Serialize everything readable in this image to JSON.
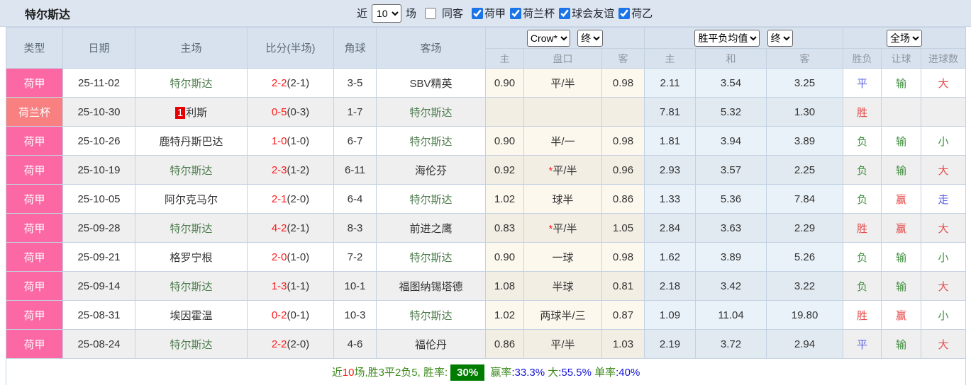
{
  "topbar": {
    "title": "特尔斯达",
    "near_label": "近",
    "matches_count": "10",
    "games_label": "场",
    "same_opponent": {
      "label": "同客",
      "checked": false
    },
    "league_filters": [
      {
        "label": "荷甲",
        "checked": true
      },
      {
        "label": "荷兰杯",
        "checked": true
      },
      {
        "label": "球会友谊",
        "checked": true
      },
      {
        "label": "荷乙",
        "checked": true
      }
    ]
  },
  "table": {
    "columns": {
      "type": "类型",
      "date": "日期",
      "home": "主场",
      "score": "比分(半场)",
      "corner": "角球",
      "away": "客场",
      "sub": [
        "主",
        "盘口",
        "客",
        "主",
        "和",
        "客",
        "胜负",
        "让球",
        "进球数"
      ]
    },
    "selects": {
      "bookmaker": "Crow*",
      "bookmaker_time": "终",
      "avg": "胜平负均值",
      "avg_time": "终",
      "scope": "全场"
    },
    "rows": [
      {
        "league": "荷甲",
        "league_style": "pink",
        "date": "25-11-02",
        "home": "特尔斯达",
        "home_green": true,
        "home_badge": "",
        "score": "2-2",
        "half": "(2-1)",
        "corner": "3-5",
        "away": "SBV精英",
        "away_green": false,
        "odds_home": "0.90",
        "handicap": "平/半",
        "handicap_star": false,
        "odds_away": "0.98",
        "avg_home": "2.11",
        "avg_draw": "3.54",
        "avg_away": "3.25",
        "result": "平",
        "handicap_result": "输",
        "goals": "大"
      },
      {
        "league": "荷兰杯",
        "league_style": "salmon",
        "date": "25-10-30",
        "home": "利斯",
        "home_green": false,
        "home_badge": "1",
        "score": "0-5",
        "half": "(0-3)",
        "corner": "1-7",
        "away": "特尔斯达",
        "away_green": true,
        "odds_home": "",
        "handicap": "",
        "handicap_star": false,
        "odds_away": "",
        "avg_home": "7.81",
        "avg_draw": "5.32",
        "avg_away": "1.30",
        "result": "胜",
        "handicap_result": "",
        "goals": ""
      },
      {
        "league": "荷甲",
        "league_style": "pink",
        "date": "25-10-26",
        "home": "鹿特丹斯巴达",
        "home_green": false,
        "home_badge": "",
        "score": "1-0",
        "half": "(1-0)",
        "corner": "6-7",
        "away": "特尔斯达",
        "away_green": true,
        "odds_home": "0.90",
        "handicap": "半/一",
        "handicap_star": false,
        "odds_away": "0.98",
        "avg_home": "1.81",
        "avg_draw": "3.94",
        "avg_away": "3.89",
        "result": "负",
        "handicap_result": "输",
        "goals": "小"
      },
      {
        "league": "荷甲",
        "league_style": "pink",
        "date": "25-10-19",
        "home": "特尔斯达",
        "home_green": true,
        "home_badge": "",
        "score": "2-3",
        "half": "(1-2)",
        "corner": "6-11",
        "away": "海伦芬",
        "away_green": false,
        "odds_home": "0.92",
        "handicap": "平/半",
        "handicap_star": true,
        "odds_away": "0.96",
        "avg_home": "2.93",
        "avg_draw": "3.57",
        "avg_away": "2.25",
        "result": "负",
        "handicap_result": "输",
        "goals": "大"
      },
      {
        "league": "荷甲",
        "league_style": "pink",
        "date": "25-10-05",
        "home": "阿尔克马尔",
        "home_green": false,
        "home_badge": "",
        "score": "2-1",
        "half": "(2-0)",
        "corner": "6-4",
        "away": "特尔斯达",
        "away_green": true,
        "odds_home": "1.02",
        "handicap": "球半",
        "handicap_star": false,
        "odds_away": "0.86",
        "avg_home": "1.33",
        "avg_draw": "5.36",
        "avg_away": "7.84",
        "result": "负",
        "handicap_result": "赢",
        "goals": "走"
      },
      {
        "league": "荷甲",
        "league_style": "pink",
        "date": "25-09-28",
        "home": "特尔斯达",
        "home_green": true,
        "home_badge": "",
        "score": "4-2",
        "half": "(2-1)",
        "corner": "8-3",
        "away": "前进之鹰",
        "away_green": false,
        "odds_home": "0.83",
        "handicap": "平/半",
        "handicap_star": true,
        "odds_away": "1.05",
        "avg_home": "2.84",
        "avg_draw": "3.63",
        "avg_away": "2.29",
        "result": "胜",
        "handicap_result": "赢",
        "goals": "大"
      },
      {
        "league": "荷甲",
        "league_style": "pink",
        "date": "25-09-21",
        "home": "格罗宁根",
        "home_green": false,
        "home_badge": "",
        "score": "2-0",
        "half": "(1-0)",
        "corner": "7-2",
        "away": "特尔斯达",
        "away_green": true,
        "odds_home": "0.90",
        "handicap": "一球",
        "handicap_star": false,
        "odds_away": "0.98",
        "avg_home": "1.62",
        "avg_draw": "3.89",
        "avg_away": "5.26",
        "result": "负",
        "handicap_result": "输",
        "goals": "小"
      },
      {
        "league": "荷甲",
        "league_style": "pink",
        "date": "25-09-14",
        "home": "特尔斯达",
        "home_green": true,
        "home_badge": "",
        "score": "1-3",
        "half": "(1-1)",
        "corner": "10-1",
        "away": "福图纳锡塔德",
        "away_green": false,
        "odds_home": "1.08",
        "handicap": "半球",
        "handicap_star": false,
        "odds_away": "0.81",
        "avg_home": "2.18",
        "avg_draw": "3.42",
        "avg_away": "3.22",
        "result": "负",
        "handicap_result": "输",
        "goals": "大"
      },
      {
        "league": "荷甲",
        "league_style": "pink",
        "date": "25-08-31",
        "home": "埃因霍温",
        "home_green": false,
        "home_badge": "",
        "score": "0-2",
        "half": "(0-1)",
        "corner": "10-3",
        "away": "特尔斯达",
        "away_green": true,
        "odds_home": "1.02",
        "handicap": "两球半/三",
        "handicap_star": false,
        "odds_away": "0.87",
        "avg_home": "1.09",
        "avg_draw": "11.04",
        "avg_away": "19.80",
        "result": "胜",
        "handicap_result": "赢",
        "goals": "小"
      },
      {
        "league": "荷甲",
        "league_style": "pink",
        "date": "25-08-24",
        "home": "特尔斯达",
        "home_green": true,
        "home_badge": "",
        "score": "2-2",
        "half": "(2-0)",
        "corner": "4-6",
        "away": "福伦丹",
        "away_green": false,
        "odds_home": "0.86",
        "handicap": "平/半",
        "handicap_star": false,
        "odds_away": "1.03",
        "avg_home": "2.19",
        "avg_draw": "3.72",
        "avg_away": "2.94",
        "result": "平",
        "handicap_result": "输",
        "goals": "大"
      }
    ]
  },
  "summary": {
    "segments": [
      {
        "text": "近",
        "style": "green"
      },
      {
        "text": "10",
        "style": "red"
      },
      {
        "text": "场,胜3平2负5, 胜率:",
        "style": "green"
      },
      {
        "text": "30%",
        "style": "badge"
      },
      {
        "text": " 赢率",
        "style": "green"
      },
      {
        "text": ":33.3%",
        "style": "blue"
      },
      {
        "text": " 大",
        "style": "green"
      },
      {
        "text": ":55.5%",
        "style": "blue"
      },
      {
        "text": " 单率",
        "style": "green"
      },
      {
        "text": ":40%",
        "style": "blue"
      }
    ]
  },
  "colors": {
    "accent_pink": "#fb68a4",
    "accent_salmon": "#f88080",
    "team_green": "#4e7d4e",
    "score_red": "#fe1a1a",
    "win_red": "#e64a4a",
    "lose_green": "#3e8e3e",
    "draw_blue": "#5d66e0",
    "summary_badge_green": "#007d00",
    "summary_blue": "#1414d6",
    "checkbox_blue": "#1b74e8"
  }
}
